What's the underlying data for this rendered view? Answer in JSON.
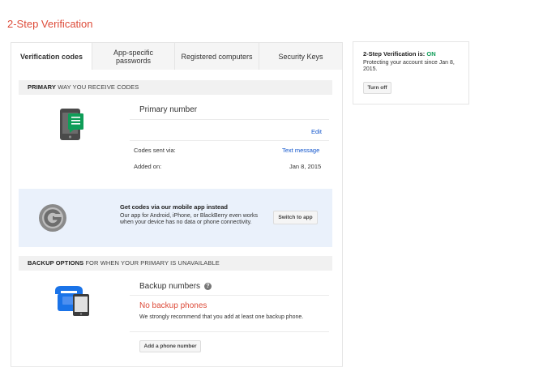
{
  "page": {
    "title": "2-Step Verification"
  },
  "tabs": [
    {
      "label": "Verification codes",
      "active": true
    },
    {
      "label": "App-specific passwords",
      "active": false
    },
    {
      "label": "Registered computers",
      "active": false
    },
    {
      "label": "Security Keys",
      "active": false
    }
  ],
  "primary": {
    "header_bold": "PRIMARY",
    "header_rest": "WAY YOU RECEIVE CODES",
    "heading": "Primary number",
    "edit_label": "Edit",
    "codes_sent_label": "Codes sent via:",
    "codes_sent_value": "Text message",
    "added_label": "Added on:",
    "added_value": "Jan 8, 2015"
  },
  "promo": {
    "title": "Get codes via our mobile app instead",
    "body": "Our app for Android, iPhone, or BlackBerry even works when your device has no data or phone connectivity.",
    "button": "Switch to app"
  },
  "backup": {
    "header_bold": "BACKUP OPTIONS",
    "header_rest": "FOR WHEN YOUR PRIMARY IS UNAVAILABLE",
    "heading": "Backup numbers",
    "help_icon": "?",
    "none_label": "No backup phones",
    "recommend": "We strongly recommend that you add at least one backup phone.",
    "add_button": "Add a phone number"
  },
  "status_box": {
    "label": "2-Step Verification is:",
    "state": "ON",
    "since": "Protecting your account since Jan 8, 2015.",
    "button": "Turn off"
  },
  "colors": {
    "title_red": "#dd4b39",
    "link_blue": "#1155cc",
    "on_green": "#0f9d58",
    "phone_green": "#0f9d58"
  },
  "icons": {
    "primary": "phone-with-message-icon",
    "promo": "authenticator-app-icon",
    "backup": "landline-and-tablet-icon"
  }
}
